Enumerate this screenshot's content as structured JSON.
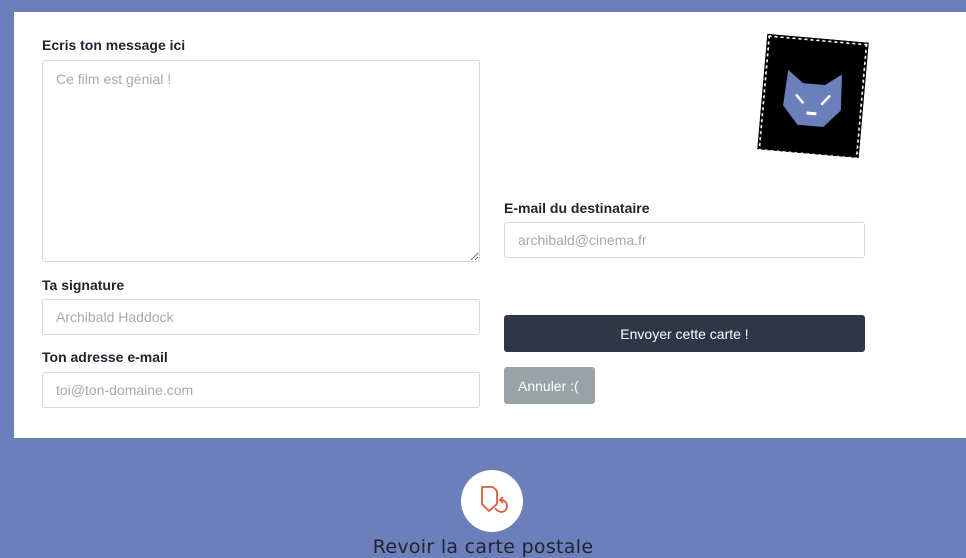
{
  "form": {
    "message_label": "Ecris ton message ici",
    "message_placeholder": "Ce film est génial !",
    "signature_label": "Ta signature",
    "signature_placeholder": "Archibald Haddock",
    "email_label": "Ton adresse e-mail",
    "email_placeholder": "toi@ton-domaine.com",
    "recipient_label": "E-mail du destinataire",
    "recipient_placeholder": "archibald@cinema.fr"
  },
  "actions": {
    "send_label": "Envoyer cette carte !",
    "cancel_label": "Annuler :("
  },
  "stamp": {
    "icon": "cat-face-icon",
    "background": "#000000",
    "face_color": "#6b7fbb"
  },
  "footer": {
    "link_label": "Revoir la carte postale",
    "icon": "postcard-return-icon",
    "icon_color": "#e05a3a"
  },
  "colors": {
    "page_background": "#6b7fbb",
    "send_button": "#2d3748",
    "cancel_button": "#98a3a6"
  }
}
